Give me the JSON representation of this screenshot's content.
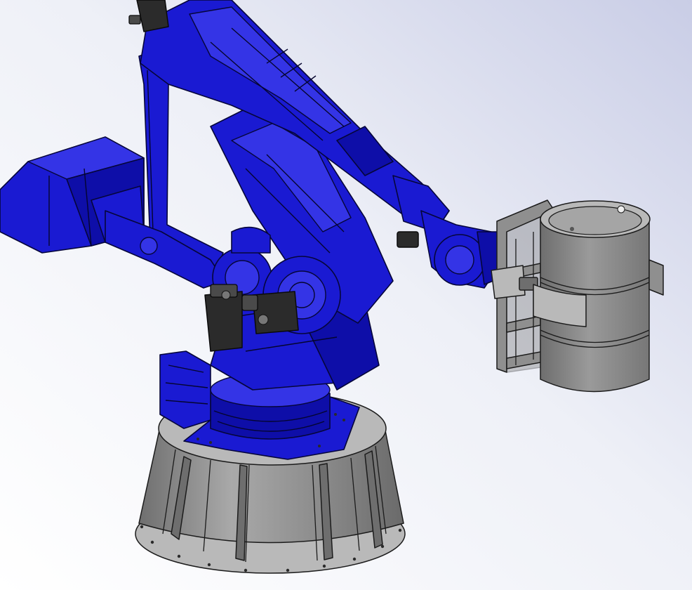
{
  "scene": {
    "background_colors": [
      "#c9cde6",
      "#eef0f7",
      "#ffffff"
    ],
    "robot_color": "#1a1ad2",
    "pedestal_color": "#8f8f8f",
    "drum_color": "#8c8c8c"
  }
}
